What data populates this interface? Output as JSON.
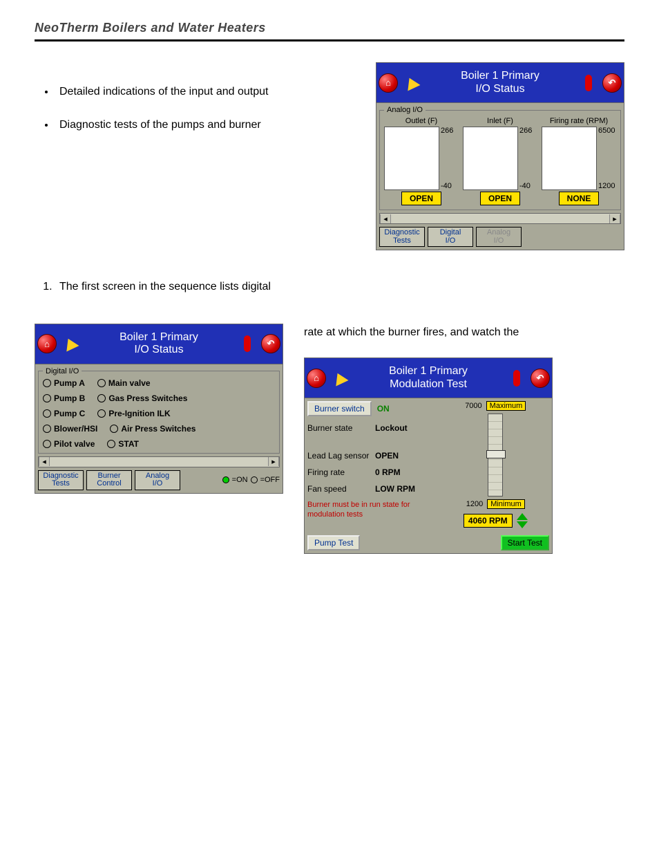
{
  "page": {
    "header": "NeoTherm Boilers and Water Heaters",
    "bullets": [
      "Detailed indications of the input and output",
      "Diagnostic tests of the pumps and burner"
    ],
    "step1": "The first screen in the sequence lists digital",
    "rightText": "rate at which the burner fires, and watch the"
  },
  "panel_analog": {
    "title_l1": "Boiler 1 Primary",
    "title_l2": "I/O Status",
    "group": "Analog I/O",
    "cols": [
      {
        "label": "Outlet (F)",
        "hi": "266",
        "lo": "-40",
        "status": "OPEN"
      },
      {
        "label": "Inlet (F)",
        "hi": "266",
        "lo": "-40",
        "status": "OPEN"
      },
      {
        "label": "Firing rate (RPM)",
        "hi": "6500",
        "lo": "1200",
        "status": "NONE"
      }
    ],
    "nav": {
      "a": "Diagnostic\nTests",
      "b": "Digital\nI/O",
      "c": "Analog\nI/O"
    }
  },
  "panel_digital": {
    "title_l1": "Boiler 1 Primary",
    "title_l2": "I/O Status",
    "group": "Digital I/O",
    "rows": [
      [
        {
          "label": "Pump A"
        },
        {
          "label": "Main valve"
        }
      ],
      [
        {
          "label": "Pump B"
        },
        {
          "label": "Gas Press Switches"
        }
      ],
      [
        {
          "label": "Pump C"
        },
        {
          "label": "Pre-Ignition ILK"
        }
      ],
      [
        {
          "label": "Blower/HSI"
        },
        {
          "label": "Air Press Switches"
        }
      ],
      [
        {
          "label": "Pilot valve"
        },
        {
          "label": "STAT"
        }
      ]
    ],
    "nav": {
      "a": "Diagnostic\nTests",
      "b": "Burner\nControl",
      "c": "Analog\nI/O"
    },
    "legend_on": "=ON",
    "legend_off": "=OFF"
  },
  "panel_mod": {
    "title_l1": "Boiler 1 Primary",
    "title_l2": "Modulation Test",
    "burner_switch_btn": "Burner switch",
    "burner_switch_val": "ON",
    "state_k": "Burner state",
    "state_v": "Lockout",
    "lead_k": "Lead Lag sensor",
    "lead_v": "OPEN",
    "fr_k": "Firing rate",
    "fr_v": "0 RPM",
    "fs_k": "Fan speed",
    "fs_v": "LOW RPM",
    "warn": "Burner must be in run state for modulation tests",
    "max_n": "7000",
    "max_t": "Maximum",
    "min_n": "1200",
    "min_t": "Minimum",
    "rpm": "4060 RPM",
    "pump_btn": "Pump Test",
    "start_btn": "Start Test"
  }
}
